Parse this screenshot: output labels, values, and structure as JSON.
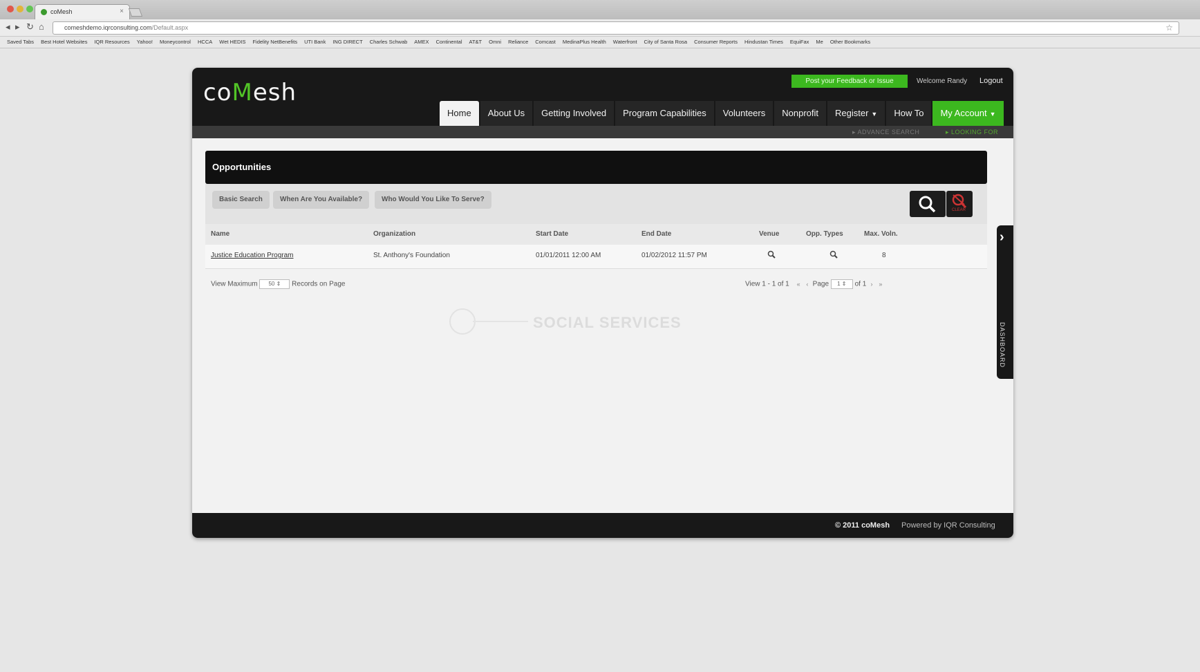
{
  "browser": {
    "tab_title": "coMesh",
    "url_main": "comeshdemo.iqrconsulting.com",
    "url_path": "/Default.aspx",
    "bookmarks": [
      "Saved Tabs",
      "Best Hotel Websites",
      "IQR Resources",
      "Yahoo!",
      "Moneycontrol",
      "HCCA",
      "Wet HEDIS",
      "Fidelity NetBenefits",
      "UTI Bank",
      "ING DIRECT",
      "Charles Schwab",
      "AMEX",
      "Continental",
      "AT&T",
      "Omni",
      "Reliance",
      "Comcast",
      "MedinaPlus Health",
      "Waterfront",
      "City of Santa Rosa",
      "Consumer Reports",
      "Hindustan Times",
      "EquiFax",
      "Me",
      "Other Bookmarks"
    ]
  },
  "header": {
    "logo_pre": "co",
    "logo_mark": "M",
    "logo_post": "esh",
    "feedback_label": "Post your Feedback or Issue",
    "welcome": "Welcome Randy",
    "logout": "Logout"
  },
  "nav": {
    "home": "Home",
    "about": "About Us",
    "getting_involved": "Getting Involved",
    "program_capabilities": "Program Capabilities",
    "volunteers": "Volunteers",
    "nonprofit": "Nonprofit",
    "register": "Register",
    "how_to": "How To",
    "my_account": "My Account"
  },
  "subbar": {
    "advance_search": "ADVANCE SEARCH",
    "looking_for": "LOOKING FOR"
  },
  "opportunities": {
    "title": "Opportunities",
    "tabs": [
      "Basic Search",
      "When Are You Available?",
      "Who Would You Like To Serve?"
    ],
    "clear_label": "CLEAR"
  },
  "table": {
    "headers": [
      "Name",
      "Organization",
      "Start Date",
      "End Date",
      "Venue",
      "Opp. Types",
      "Max. Voln."
    ],
    "rows": [
      {
        "name": "Justice Education Program",
        "organization": "St. Anthony's Foundation",
        "start": "01/01/2011 12:00 AM",
        "end": "01/02/2012 11:57 PM",
        "max": "8"
      }
    ]
  },
  "pager": {
    "view_max_label": "View Maximum",
    "view_max_value": "50",
    "records_label": "Records on Page",
    "view_range": "View 1 - 1 of 1",
    "page_label": "Page",
    "page_value": "1",
    "of_label": "of 1"
  },
  "watermark": {
    "text": "SOCIAL SERVICES"
  },
  "dashboard": {
    "label": "DASHBOARD"
  },
  "footer": {
    "copyright": "© 2011 coMesh",
    "powered": "Powered by IQR Consulting"
  },
  "colors": {
    "brand_green": "#3cb81f",
    "header_black": "#181818"
  }
}
